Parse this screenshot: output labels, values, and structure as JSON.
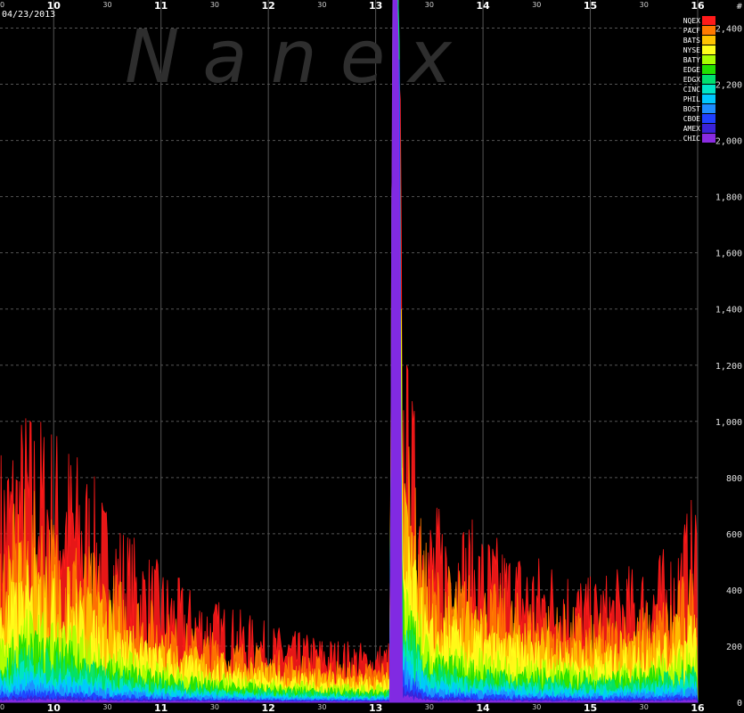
{
  "date": "04/23/2013",
  "watermark": "N a n e x",
  "y_unit": "#",
  "colors": {
    "background": "#000000",
    "grid": "#555555",
    "NQEX": "#ff1a1a",
    "PACF": "#ff7a00",
    "BATS": "#ffc400",
    "NYSE": "#ffff1a",
    "BATY": "#a8ff00",
    "EDGE": "#22e000",
    "EDGX": "#00e070",
    "CINC": "#00e6c8",
    "PHIL": "#00c8ff",
    "BOST": "#1e8cff",
    "CBOE": "#2040ff",
    "AMEX": "#3a22d8",
    "CHIC": "#8a2be2"
  },
  "chart_data": {
    "type": "area",
    "x_major_ticks": [
      "10",
      "11",
      "12",
      "13",
      "14",
      "15",
      "16"
    ],
    "x_minor_tick": "30",
    "xlim": [
      "09:30",
      "16:00"
    ],
    "ylim": [
      0,
      2500
    ],
    "y_ticks": [
      "0",
      "200",
      "400",
      "600",
      "800",
      "1,000",
      "1,200",
      "1,400",
      "1,600",
      "1,800",
      "2,000",
      "2,200",
      "2,400"
    ],
    "grid": true,
    "legend_position": "top-right",
    "stacked": true,
    "series": [
      {
        "name": "NQEX",
        "x": [
          "09:30",
          "09:45",
          "10:00",
          "10:15",
          "10:30",
          "10:45",
          "11:00",
          "11:15",
          "11:30",
          "11:45",
          "12:00",
          "12:15",
          "12:30",
          "12:45",
          "13:00",
          "13:08",
          "13:10",
          "13:12",
          "13:15",
          "13:30",
          "13:45",
          "14:00",
          "14:15",
          "14:30",
          "14:45",
          "15:00",
          "15:15",
          "15:30",
          "15:45",
          "16:00"
        ],
        "y": [
          620,
          720,
          680,
          600,
          480,
          400,
          330,
          280,
          250,
          220,
          190,
          170,
          160,
          150,
          140,
          150,
          2500,
          2500,
          900,
          480,
          460,
          420,
          380,
          360,
          340,
          300,
          320,
          340,
          380,
          520
        ]
      },
      {
        "name": "PACF",
        "y": [
          420,
          520,
          460,
          400,
          330,
          280,
          230,
          190,
          170,
          150,
          130,
          120,
          110,
          100,
          95,
          110,
          2500,
          2500,
          700,
          340,
          330,
          300,
          270,
          250,
          240,
          210,
          220,
          240,
          270,
          360
        ]
      },
      {
        "name": "BATS",
        "y": [
          320,
          400,
          360,
          300,
          250,
          210,
          170,
          140,
          125,
          110,
          95,
          88,
          80,
          74,
          70,
          80,
          2500,
          2500,
          560,
          260,
          250,
          230,
          205,
          190,
          180,
          160,
          170,
          185,
          205,
          280
        ]
      },
      {
        "name": "NYSE",
        "y": [
          260,
          330,
          300,
          250,
          200,
          170,
          140,
          115,
          100,
          90,
          78,
          72,
          65,
          60,
          58,
          65,
          2500,
          2500,
          460,
          210,
          205,
          185,
          165,
          155,
          145,
          130,
          140,
          150,
          170,
          230
        ]
      },
      {
        "name": "BATY",
        "y": [
          180,
          230,
          210,
          180,
          140,
          120,
          100,
          82,
          72,
          64,
          56,
          52,
          48,
          44,
          42,
          48,
          2500,
          2500,
          360,
          150,
          145,
          130,
          118,
          110,
          104,
          94,
          100,
          108,
          122,
          160
        ]
      },
      {
        "name": "EDGE",
        "y": [
          140,
          180,
          160,
          140,
          110,
          94,
          78,
          64,
          56,
          50,
          44,
          40,
          37,
          34,
          32,
          38,
          2500,
          2500,
          300,
          118,
          114,
          102,
          92,
          86,
          82,
          74,
          78,
          84,
          96,
          126
        ]
      },
      {
        "name": "EDGX",
        "y": [
          110,
          140,
          125,
          108,
          86,
          73,
          60,
          50,
          44,
          39,
          34,
          31,
          29,
          27,
          25,
          30,
          2500,
          2500,
          250,
          92,
          88,
          80,
          72,
          67,
          64,
          58,
          61,
          66,
          75,
          98
        ]
      },
      {
        "name": "CINC",
        "y": [
          80,
          104,
          92,
          80,
          64,
          54,
          45,
          37,
          33,
          29,
          26,
          24,
          22,
          20,
          19,
          23,
          2500,
          2500,
          200,
          70,
          66,
          60,
          54,
          50,
          48,
          43,
          46,
          50,
          56,
          74
        ]
      },
      {
        "name": "PHIL",
        "y": [
          60,
          78,
          70,
          60,
          48,
          40,
          34,
          28,
          25,
          22,
          20,
          18,
          17,
          16,
          15,
          18,
          2500,
          2500,
          160,
          54,
          51,
          46,
          42,
          39,
          37,
          33,
          35,
          38,
          43,
          56
        ]
      },
      {
        "name": "BOST",
        "y": [
          42,
          54,
          48,
          42,
          34,
          28,
          24,
          20,
          18,
          16,
          14,
          13,
          12,
          11,
          11,
          13,
          2500,
          2500,
          120,
          38,
          36,
          33,
          30,
          28,
          26,
          24,
          25,
          27,
          31,
          40
        ]
      },
      {
        "name": "CBOE",
        "y": [
          26,
          34,
          30,
          26,
          21,
          18,
          15,
          13,
          11,
          10,
          9,
          8,
          8,
          7,
          7,
          8,
          2500,
          2500,
          80,
          24,
          23,
          21,
          19,
          18,
          17,
          15,
          16,
          17,
          20,
          25
        ]
      },
      {
        "name": "AMEX",
        "y": [
          14,
          18,
          16,
          14,
          11,
          10,
          8,
          7,
          6,
          6,
          5,
          5,
          4,
          4,
          4,
          5,
          2500,
          2500,
          40,
          13,
          12,
          11,
          10,
          10,
          9,
          8,
          9,
          9,
          11,
          14
        ]
      },
      {
        "name": "CHIC",
        "y": [
          6,
          8,
          7,
          6,
          5,
          4,
          4,
          3,
          3,
          3,
          2,
          2,
          2,
          2,
          2,
          2,
          2500,
          2500,
          20,
          6,
          6,
          5,
          5,
          4,
          4,
          4,
          4,
          4,
          5,
          6
        ]
      }
    ]
  }
}
